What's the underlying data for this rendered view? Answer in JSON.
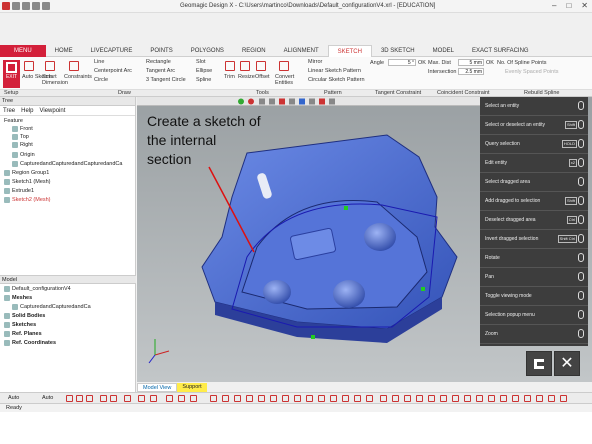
{
  "window": {
    "title": "Geomagic Design X - C:\\Users\\martinco\\Downloads\\Default_configurationV4.xrl - [EDUCATION]",
    "controls": [
      "–",
      "□",
      "✕"
    ]
  },
  "tabs": [
    "MENU",
    "HOME",
    "LIVECAPTURE",
    "POINTS",
    "POLYGONS",
    "REGION",
    "ALIGNMENT",
    "SKETCH",
    "3D SKETCH",
    "MODEL",
    "EXACT SURFACING"
  ],
  "active_tab": "SKETCH",
  "ribbon": {
    "exit": "EXIT",
    "auto_sketch": "Auto Sketch",
    "smart_dimension": "Smart Dimension",
    "constraints": "Constraints",
    "line": "Line",
    "centerpoint_arc": "Centerpoint Arc",
    "circle": "Circle",
    "rectangle": "Rectangle",
    "tangent_arc": "Tangent Arc",
    "tangent_circle": "3 Tangent Circle",
    "slot": "Slot",
    "ellipse": "Ellipse",
    "spline": "Spline",
    "trim": "Trim",
    "resize": "Resize",
    "offset": "Offset",
    "convert_entities": "Convert Entities",
    "mirror": "Mirror",
    "linear_pattern": "Linear Sketch Pattern",
    "circular_pattern": "Circular Sketch Pattern",
    "angle_label": "Angle",
    "angle_value": "5 °",
    "ok": "OK",
    "max_dist_label": "Max. Dist",
    "max_dist_value": "5 mm",
    "intersection_label": "Intersection",
    "intersection_value": "2.5 mm",
    "spline_points_label": "No. Of Spline Points",
    "evenly_spaced": "Evenly Spaced Points"
  },
  "group_labels": [
    "Setup",
    "Draw",
    "Tools",
    "Pattern",
    "Tangent Constraint",
    "Coincident Constraint",
    "Rebuild Spline"
  ],
  "left_panel": {
    "header": "Tree",
    "tabs": [
      "Tree",
      "Help",
      "Viewpoint"
    ],
    "feature_label": "Feature",
    "items": [
      "Front",
      "Top",
      "Right",
      "Origin",
      "CapturedandCapturedandCapturedandCa",
      "Region Group1",
      "Sketch1 (Mesh)",
      "Extrude1",
      "Sketch2 (Mesh)"
    ],
    "model_header": "Model",
    "model_items": [
      "Default_configurationV4",
      "Meshes",
      "CapturedandCapturedandCa",
      "Solid Bodies",
      "Sketches",
      "Ref. Planes",
      "Ref. Coordinates"
    ]
  },
  "annotation": [
    "Create a sketch of",
    "the internal",
    "section"
  ],
  "hotkeys": [
    {
      "label": "Select an entity",
      "keys": [
        "mouse"
      ]
    },
    {
      "label": "Select or deselect an entity",
      "keys": [
        "Shift",
        "mouse"
      ]
    },
    {
      "label": "Query selection",
      "keys": [
        "HOLD",
        "mouse"
      ]
    },
    {
      "label": "Edit entity",
      "keys": [
        "x2",
        "mouse"
      ]
    },
    {
      "label": "Select dragged area",
      "keys": [
        "mouse"
      ]
    },
    {
      "label": "Add dragged to selection",
      "keys": [
        "Shift",
        "mouse"
      ]
    },
    {
      "label": "Deselect dragged area",
      "keys": [
        "Ctrl",
        "mouse"
      ]
    },
    {
      "label": "Invert dragged selection",
      "keys": [
        "Shift Ctrl",
        "mouse"
      ]
    },
    {
      "label": "Rotate",
      "keys": [
        "mouse"
      ]
    },
    {
      "label": "Pan",
      "keys": [
        "mouse"
      ]
    },
    {
      "label": "Toggle viewing mode",
      "keys": [
        "mouse"
      ]
    },
    {
      "label": "Selection popup menu",
      "keys": [
        "mouse"
      ]
    },
    {
      "label": "Zoom",
      "keys": [
        "mouse"
      ]
    }
  ],
  "bottom_tabs": [
    "Model View",
    "Support"
  ],
  "auto_labels": [
    "Auto",
    "Auto"
  ],
  "status": "Ready",
  "colors": {
    "accent": "#d3203a",
    "mesh": "#4f6fd1",
    "hotkey_bg": "#3d3d3d"
  }
}
